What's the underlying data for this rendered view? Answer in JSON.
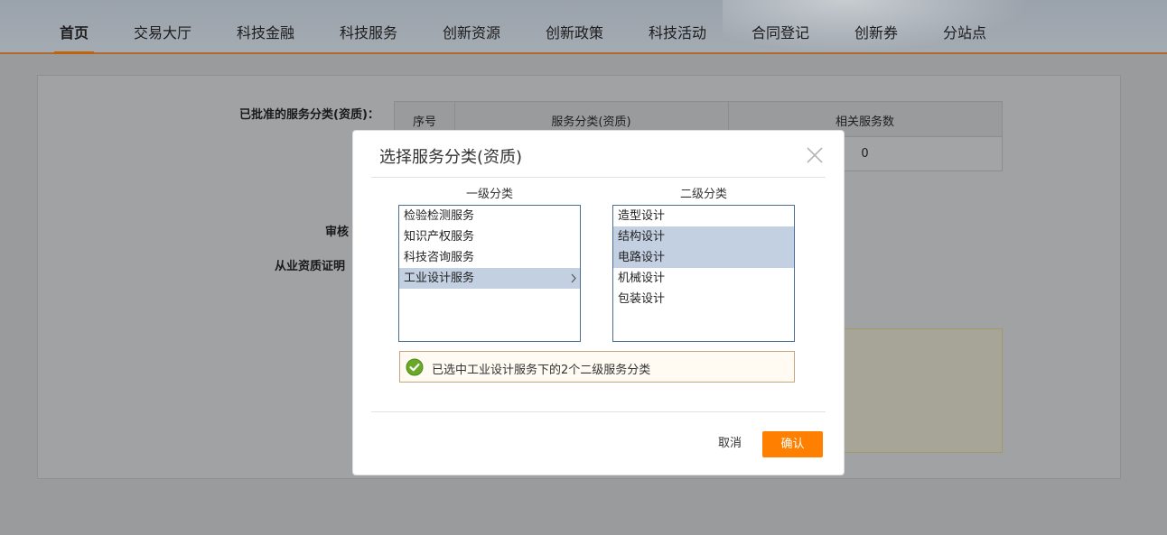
{
  "nav": {
    "items": [
      "首页",
      "交易大厅",
      "科技金融",
      "科技服务",
      "创新资源",
      "创新政策",
      "科技活动",
      "合同登记",
      "创新券",
      "分站点"
    ],
    "active_index": 0
  },
  "page": {
    "approved_label": "已批准的服务分类(资质)：",
    "audit_label": "审核",
    "cert_label": "从业资质证明",
    "table": {
      "headers": [
        "序号",
        "服务分类(资质)",
        "相关服务数"
      ],
      "row_count": "0"
    }
  },
  "modal": {
    "title": "选择服务分类(资质)",
    "level1_title": "一级分类",
    "level2_title": "二级分类",
    "level1_items": [
      "检验检测服务",
      "知识产权服务",
      "科技咨询服务",
      "工业设计服务"
    ],
    "level1_selected": 3,
    "level2_items": [
      "造型设计",
      "结构设计",
      "电路设计",
      "机械设计",
      "包装设计"
    ],
    "level2_selected": [
      1,
      2
    ],
    "notice": "已选中工业设计服务下的2个二级服务分类",
    "cancel_label": "取消",
    "confirm_label": "确认"
  },
  "icons": {
    "close": "close-icon",
    "chevron": "chevron-right-icon",
    "check": "check-circle-icon"
  },
  "colors": {
    "accent": "#ff8000",
    "selection": "#c3d0e2",
    "success": "#6aa82a"
  }
}
